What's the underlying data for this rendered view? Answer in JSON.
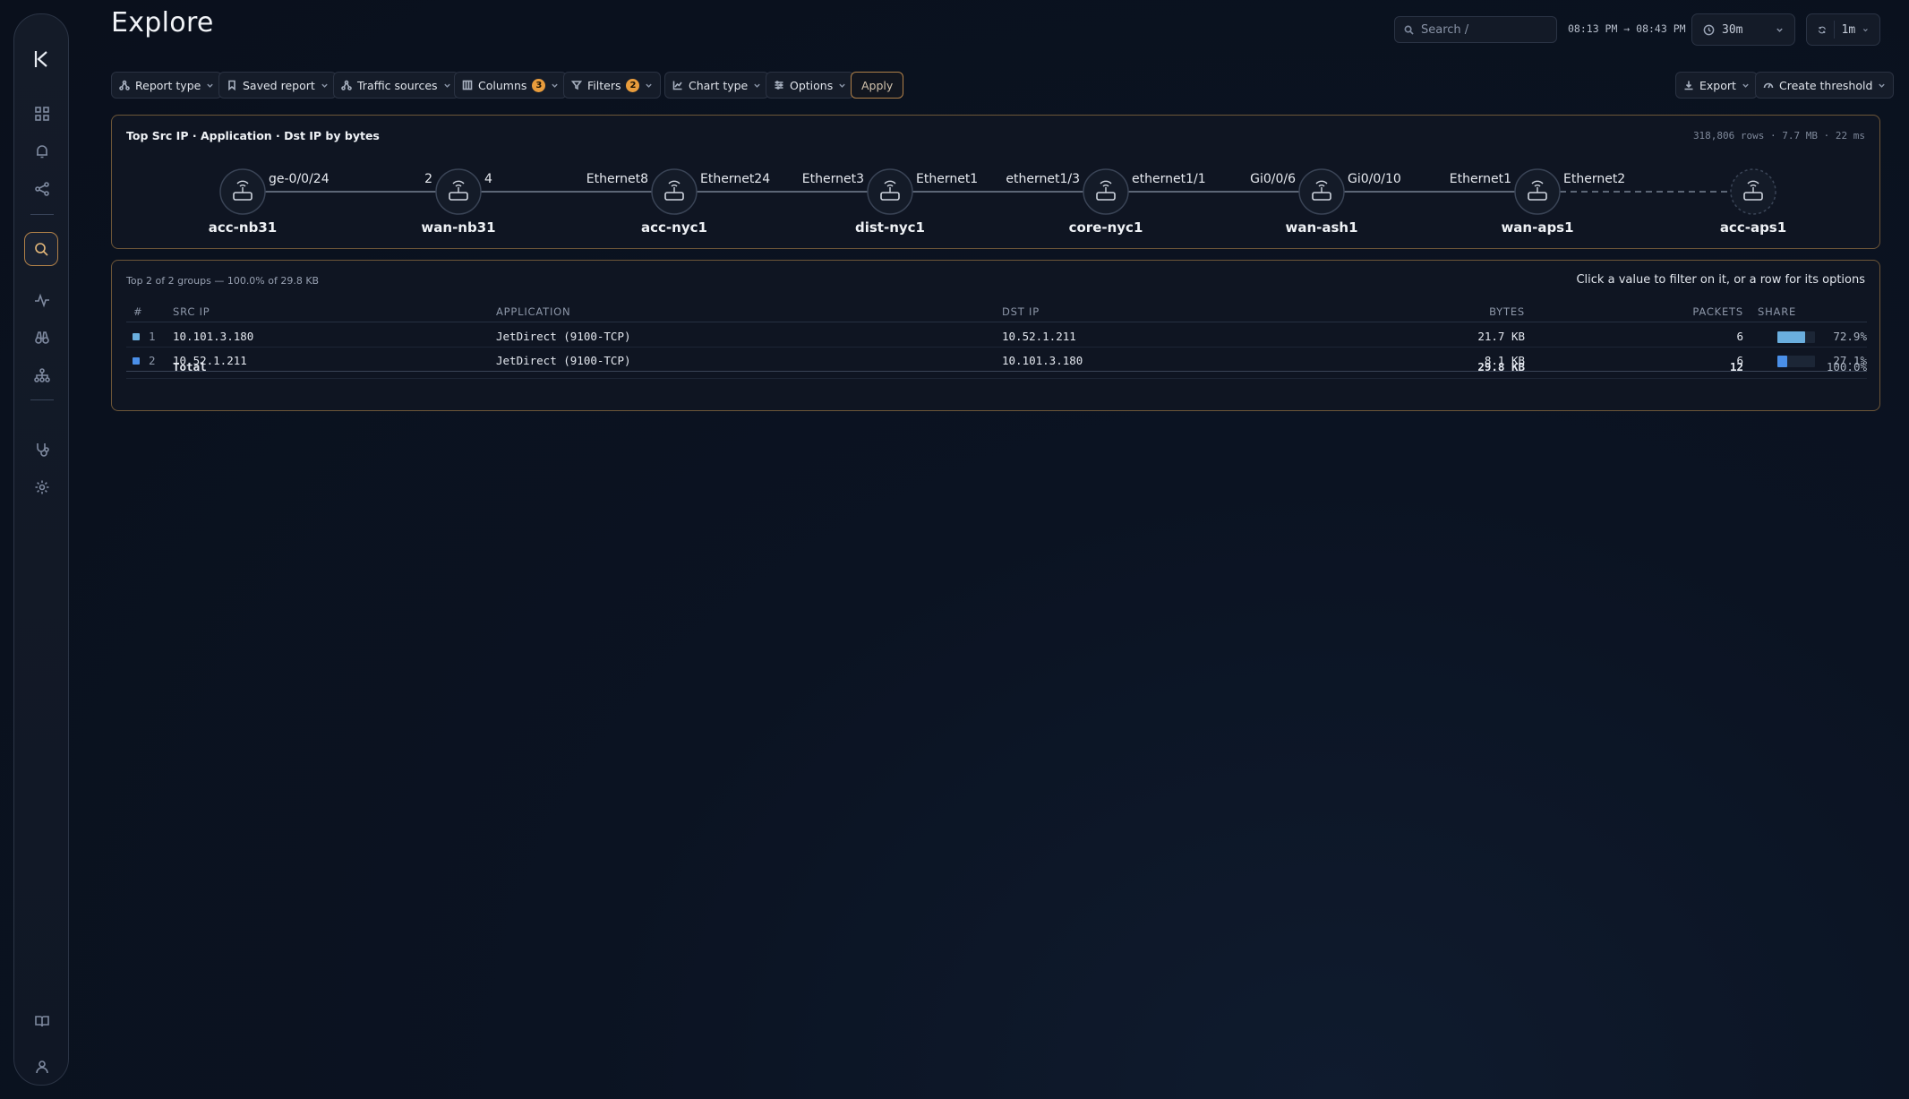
{
  "page": {
    "title": "Explore"
  },
  "header": {
    "search_placeholder": "Search /",
    "time_range": "08:13 PM → 08:43 PM",
    "duration": "30m",
    "refresh_interval": "1m"
  },
  "toolbar": {
    "report_type": "Report type",
    "saved_report": "Saved report",
    "traffic_sources": "Traffic sources",
    "columns": "Columns",
    "columns_count": "3",
    "filters": "Filters",
    "filters_count": "2",
    "chart_type": "Chart type",
    "options": "Options",
    "apply": "Apply",
    "export": "Export",
    "create_threshold": "Create threshold"
  },
  "path_panel": {
    "title": "Top Src IP · Application · Dst IP by bytes",
    "meta": "318,806 rows · 7.7 MB · 22 ms",
    "nodes": [
      "acc-nb31",
      "wan-nb31",
      "acc-nyc1",
      "dist-nyc1",
      "core-nyc1",
      "wan-ash1",
      "wan-aps1",
      "acc-aps1"
    ],
    "links": [
      {
        "out": "ge-0/0/24",
        "in": "2",
        "style": "solid"
      },
      {
        "out": "4",
        "in": "Ethernet8",
        "style": "solid"
      },
      {
        "out": "Ethernet24",
        "in": "Ethernet3",
        "style": "solid"
      },
      {
        "out": "Ethernet1",
        "in": "ethernet1/3",
        "style": "solid"
      },
      {
        "out": "ethernet1/1",
        "in": "Gi0/0/6",
        "style": "solid"
      },
      {
        "out": "Gi0/0/10",
        "in": "Ethernet1",
        "style": "solid"
      },
      {
        "out": "Ethernet2",
        "in": "",
        "style": "dashed"
      }
    ]
  },
  "table_panel": {
    "subheading": "Top 2 of 2 groups — 100.0% of 29.8 KB",
    "hint": "Click a value to filter on it, or a row for its options",
    "columns": {
      "idx": "#",
      "src_ip": "SRC IP",
      "application": "APPLICATION",
      "dst_ip": "DST IP",
      "bytes": "BYTES",
      "packets": "PACKETS",
      "share": "SHARE"
    },
    "rows": [
      {
        "idx": "1",
        "src_ip": "10.101.3.180",
        "application": "JetDirect (9100-TCP)",
        "dst_ip": "10.52.1.211",
        "bytes": "21.7 KB",
        "packets": "6",
        "share": "72.9%",
        "share_value": 72.9,
        "color": "#6aaede"
      },
      {
        "idx": "2",
        "src_ip": "10.52.1.211",
        "application": "JetDirect (9100-TCP)",
        "dst_ip": "10.101.3.180",
        "bytes": "8.1 KB",
        "packets": "6",
        "share": "27.1%",
        "share_value": 27.1,
        "color": "#4a8fe8"
      }
    ],
    "total": {
      "label": "Total",
      "bytes": "29.8 KB",
      "packets": "12",
      "share": "100.0%"
    }
  },
  "colors": {
    "accent": "#b08048",
    "badge": "#e89c3c",
    "panel_border": "#6d5638"
  }
}
